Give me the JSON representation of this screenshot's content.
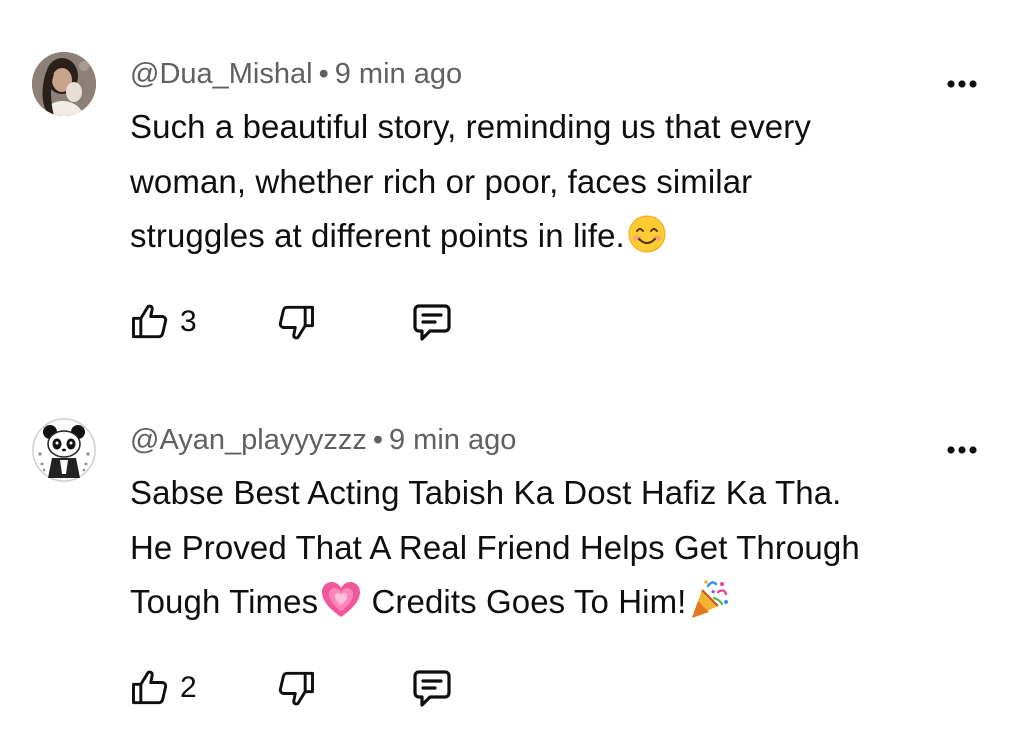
{
  "comments": [
    {
      "handle": "@Dua_Mishal",
      "separator": "•",
      "time": "9 min ago",
      "text_lines": [
        "Such a beautiful story, reminding us that every",
        "woman, whether rich or poor, faces similar",
        "struggles at different points in life."
      ],
      "trailing_emoji": "smiling-face-emoji",
      "like_count": "3",
      "avatar": "profile-photo"
    },
    {
      "handle": "@Ayan_playyyzzz",
      "separator": "•",
      "time": "9 min ago",
      "text_lines": [
        "Sabse Best Acting Tabish Ka Dost Hafiz Ka Tha.",
        "He Proved That A Real Friend Helps Get Through",
        "Tough Times",
        " Credits Goes To Him!"
      ],
      "inline_emojis": [
        "growing-heart-emoji",
        "party-popper-emoji"
      ],
      "like_count": "2",
      "avatar": "panda-avatar"
    }
  ],
  "icons": {
    "more": "more-vert-icon",
    "like": "thumb-up-icon",
    "dislike": "thumb-down-icon",
    "reply": "reply-comment-icon"
  },
  "colors": {
    "text": "#0f0f0f",
    "meta": "#606060",
    "background": "#ffffff"
  }
}
